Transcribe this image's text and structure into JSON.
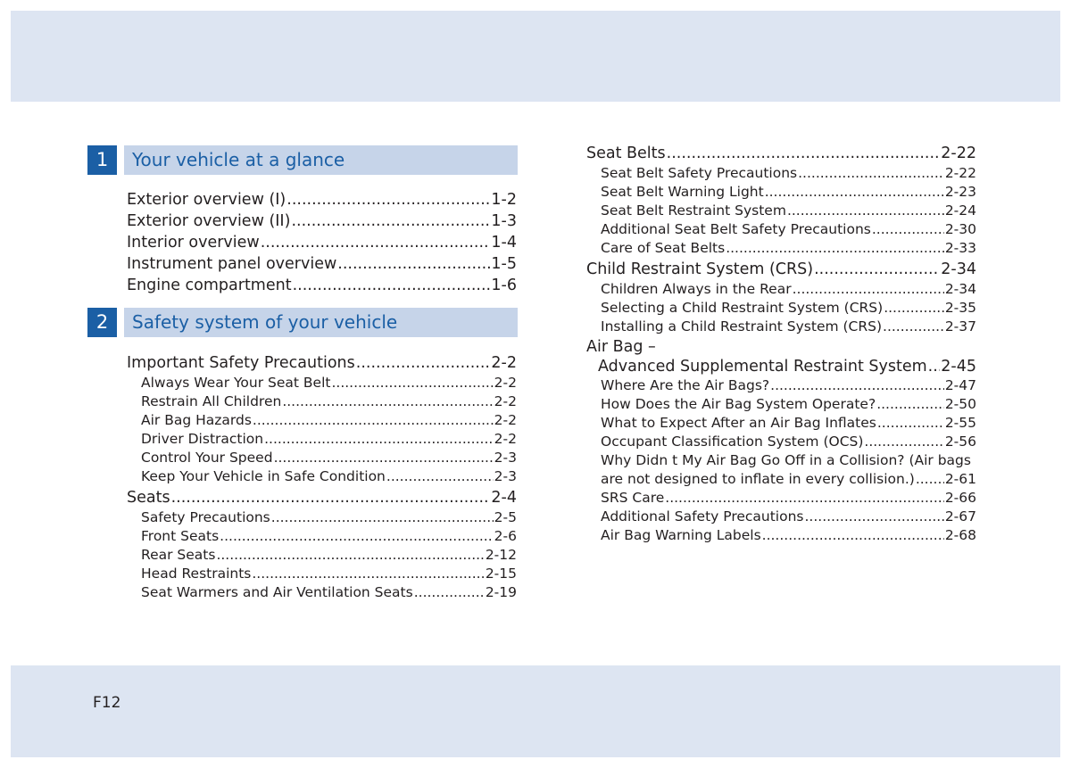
{
  "folio": "F12",
  "colors": {
    "section_box": "#1b5fa5",
    "section_bar": "#c6d4e9",
    "band": "#dde5f2"
  },
  "left": {
    "sections": [
      {
        "number": "1",
        "title": "Your vehicle at a glance"
      },
      {
        "number": "2",
        "title": "Safety system of your vehicle"
      }
    ],
    "entries": [
      {
        "level": "main",
        "label": "Exterior overview (I)",
        "page": "1-2"
      },
      {
        "level": "main",
        "label": "Exterior overview (II)",
        "page": "1-3"
      },
      {
        "level": "main",
        "label": "Interior overview",
        "page": "1-4"
      },
      {
        "level": "main",
        "label": "Instrument panel overview",
        "page": "1-5"
      },
      {
        "level": "main",
        "label": "Engine compartment",
        "page": "1-6"
      },
      {
        "level": "main",
        "label": "Important Safety Precautions",
        "page": "2-2"
      },
      {
        "level": "sub",
        "label": "Always Wear Your Seat Belt",
        "page": "2-2"
      },
      {
        "level": "sub",
        "label": "Restrain All Children",
        "page": "2-2"
      },
      {
        "level": "sub",
        "label": "Air Bag Hazards",
        "page": "2-2"
      },
      {
        "level": "sub",
        "label": "Driver Distraction",
        "page": "2-2"
      },
      {
        "level": "sub",
        "label": "Control Your Speed",
        "page": "2-3"
      },
      {
        "level": "sub",
        "label": "Keep Your Vehicle in Safe Condition",
        "page": "2-3"
      },
      {
        "level": "main",
        "label": "Seats",
        "page": "2-4"
      },
      {
        "level": "sub",
        "label": "Safety Precautions",
        "page": "2-5"
      },
      {
        "level": "sub",
        "label": "Front Seats",
        "page": "2-6"
      },
      {
        "level": "sub",
        "label": "Rear Seats",
        "page": "2-12"
      },
      {
        "level": "sub",
        "label": "Head Restraints",
        "page": "2-15"
      },
      {
        "level": "sub",
        "label": "Seat Warmers and Air Ventilation Seats",
        "page": "2-19"
      }
    ]
  },
  "right": {
    "entries": [
      {
        "level": "main",
        "label": "Seat Belts",
        "page": "2-22"
      },
      {
        "level": "sub",
        "label": "Seat Belt Safety Precautions",
        "page": "2-22"
      },
      {
        "level": "sub",
        "label": "Seat Belt Warning Light",
        "page": "2-23"
      },
      {
        "level": "sub",
        "label": "Seat Belt Restraint System",
        "page": "2-24"
      },
      {
        "level": "sub",
        "label": "Additional Seat Belt Safety Precautions",
        "page": "2-30"
      },
      {
        "level": "sub",
        "label": "Care of Seat Belts",
        "page": "2-33"
      },
      {
        "level": "main",
        "label": "Child Restraint System (CRS)",
        "page": "2-34"
      },
      {
        "level": "sub",
        "label": "Children Always in the Rear",
        "page": "2-34"
      },
      {
        "level": "sub",
        "label": "Selecting a Child Restraint System (CRS)",
        "page": "2-35"
      },
      {
        "level": "sub",
        "label": "Installing a Child Restraint System (CRS)",
        "page": "2-37"
      },
      {
        "level": "main",
        "label": "Air Bag –",
        "page": ""
      },
      {
        "level": "main",
        "label": "Advanced Supplemental Restraint System",
        "page": "2-45"
      },
      {
        "level": "sub",
        "label": "Where Are the Air Bags?",
        "page": "2-47"
      },
      {
        "level": "sub",
        "label": "How Does the Air Bag System Operate?",
        "page": "2-50"
      },
      {
        "level": "sub",
        "label": "What to Expect After an Air Bag Inflates",
        "page": "2-55"
      },
      {
        "level": "sub",
        "label": "Occupant Classification System (OCS)",
        "page": "2-56"
      },
      {
        "level": "sub",
        "label": "Why Didn   t My Air Bag Go Off in a Collision? (Air bags",
        "page": ""
      },
      {
        "level": "sub",
        "label": "are not designed to inflate in every collision.)",
        "page": "2-61"
      },
      {
        "level": "sub",
        "label": "SRS Care",
        "page": "2-66"
      },
      {
        "level": "sub",
        "label": "Additional Safety Precautions",
        "page": "2-67"
      },
      {
        "level": "sub",
        "label": "Air Bag Warning Labels",
        "page": "2-68"
      }
    ]
  }
}
